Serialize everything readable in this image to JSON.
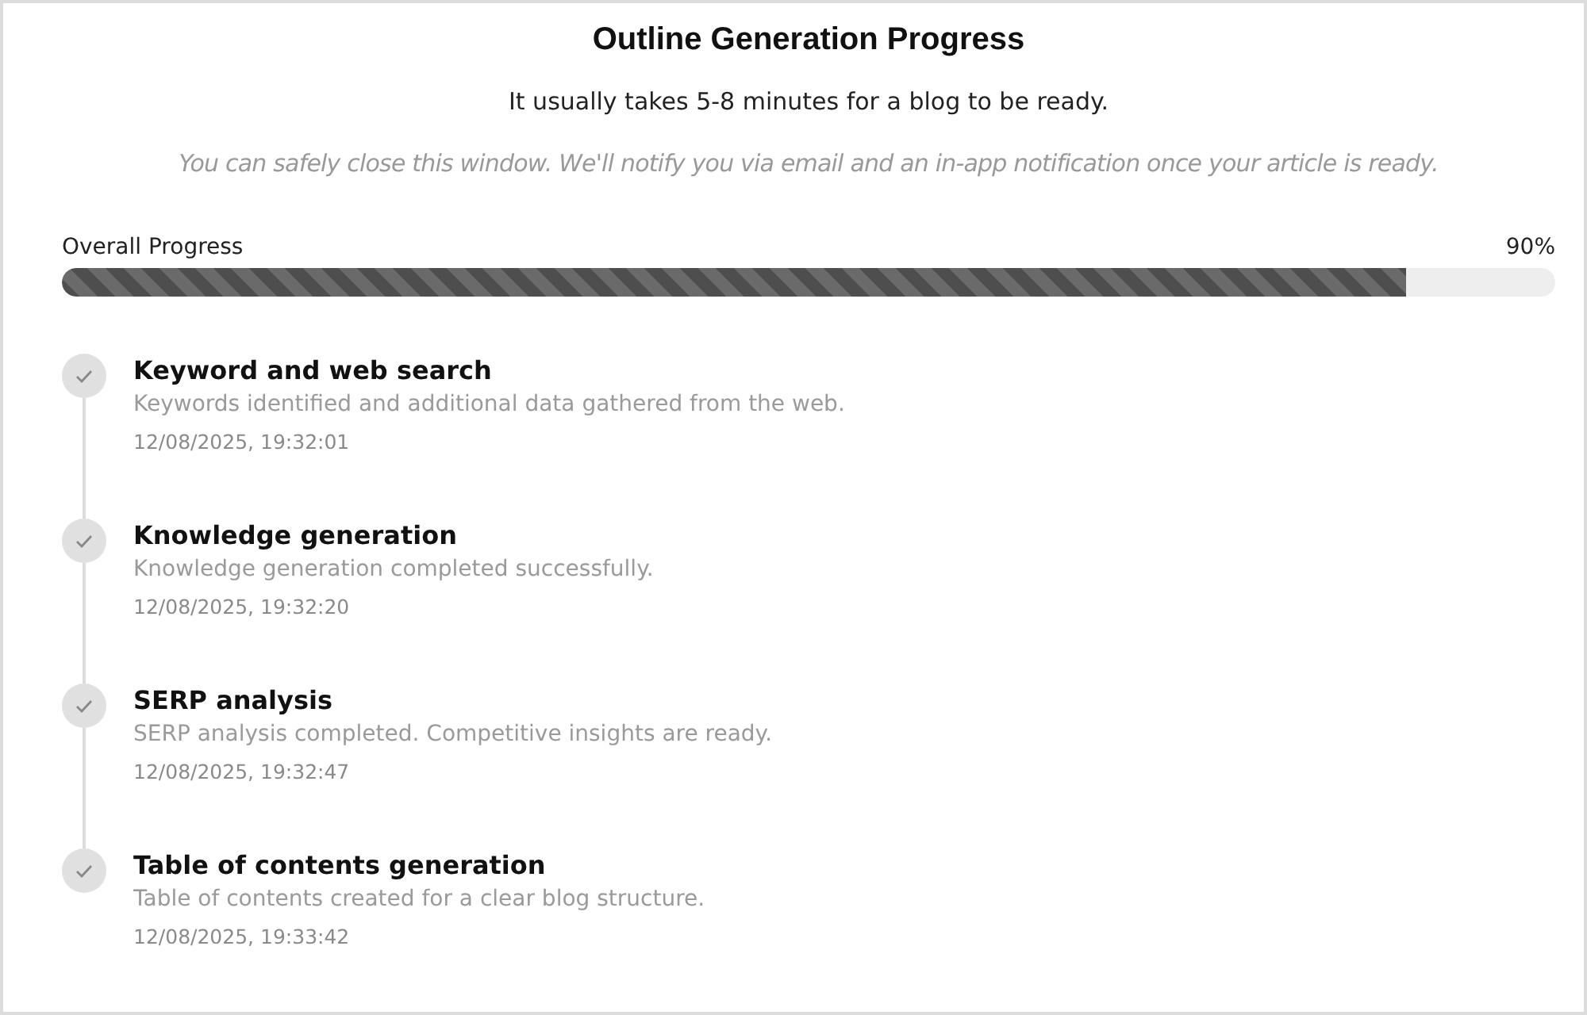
{
  "title": "Outline Generation Progress",
  "subtitle": "It usually takes 5-8 minutes for a blog to be ready.",
  "notice": "You can safely close this window. We'll notify you via email and an in-app notification once your article is ready.",
  "progress": {
    "label": "Overall Progress",
    "reading": "90%",
    "level": 0.9
  },
  "steps": [
    {
      "title": "Keyword and web search",
      "description": "Keywords identified and additional data gathered from the web.",
      "time": "12/08/2025, 19:32:01",
      "completed": true
    },
    {
      "title": "Knowledge generation",
      "description": "Knowledge generation completed successfully.",
      "time": "12/08/2025, 19:32:20",
      "completed": true
    },
    {
      "title": "SERP analysis",
      "description": "SERP analysis completed. Competitive insights are ready.",
      "time": "12/08/2025, 19:32:47",
      "completed": true
    },
    {
      "title": "Table of contents generation",
      "description": "Table of contents created for a clear blog structure.",
      "time": "12/08/2025, 19:33:42",
      "completed": true
    }
  ]
}
